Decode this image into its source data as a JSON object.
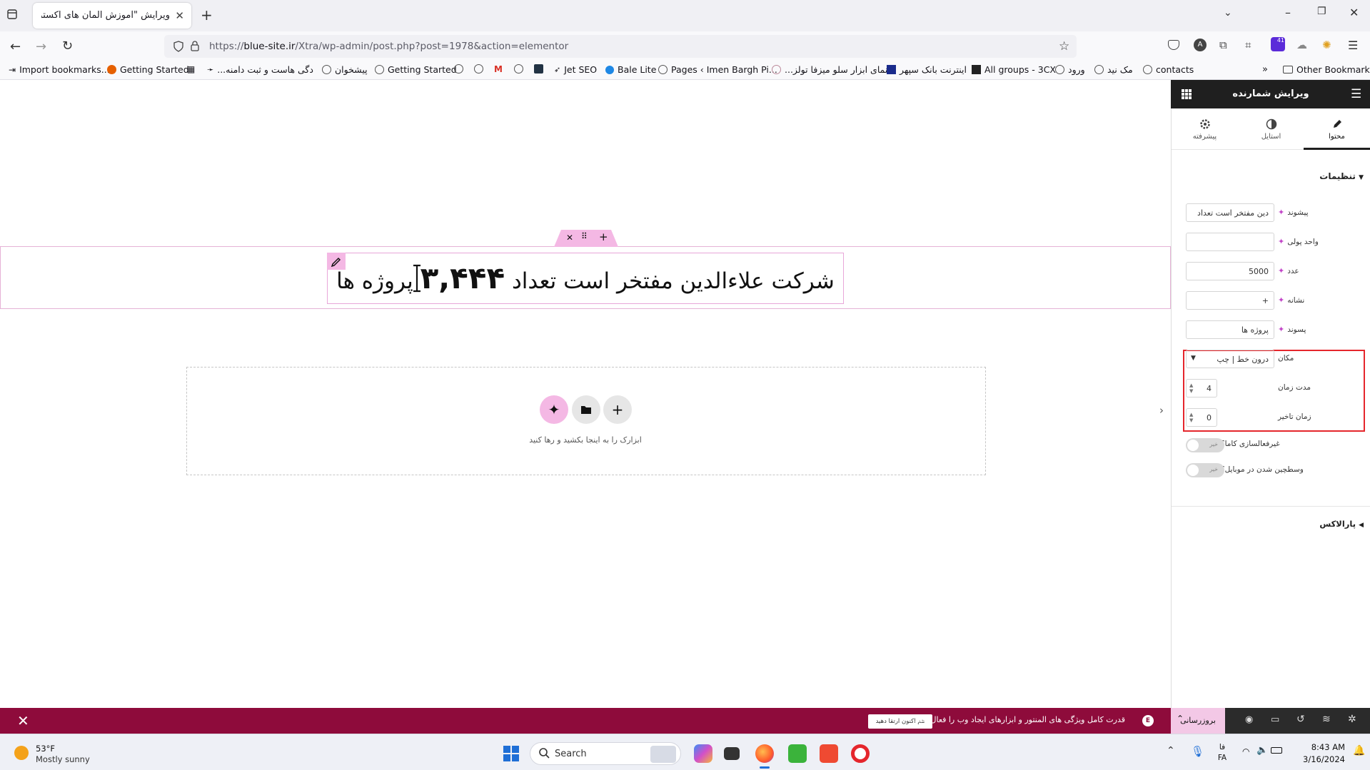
{
  "browser": {
    "tab_title": "ویرایش \"آموزش المان های اکسترا – ...",
    "url_prefix": "https://",
    "url_domain": "blue-site.ir",
    "url_rest": "/Xtra/wp-admin/post.php?post=1978&action=elementor",
    "extension_badge": "41",
    "bookmarks": [
      "Import bookmarks...",
      "Getting Started",
      "...دگی هاست و ثبت دامنه",
      "پیشخوان",
      "Getting Started",
      "Jet SEO",
      "Bale Lite",
      "Pages ‹ Imen Bargh Pi...",
      "...نمای ابزار سلو میزفا تولز",
      "اینترنت بانک سپهر",
      "All groups - 3CX",
      "ورود",
      "مک نید",
      "contacts"
    ],
    "other_bookmarks": "Other Bookmarks"
  },
  "canvas": {
    "counter_prefix": "شرکت علاءالدین مفتخر است تعداد",
    "counter_number": "۳,۴۴۴",
    "counter_suffix": "پروژه ها",
    "dropzone_text": "ابزارک را به اینجا بکشید و رها کنید"
  },
  "panel": {
    "title": "ویرایش شمارنده",
    "tabs": [
      "محتوا",
      "استایل",
      "پیشرفته"
    ],
    "section_title": "تنظیمات",
    "fields": {
      "prefix_label": "پیشوند",
      "prefix_value": "دین مفتخر است تعداد",
      "currency_label": "واحد پولی",
      "currency_value": "",
      "number_label": "عدد",
      "number_value": "5000",
      "separator_label": "نشانه",
      "separator_value": "+",
      "suffix_label": "پسوند",
      "suffix_value": "پروژه ها",
      "position_label": "مکان",
      "position_value": "درون خط | چپ",
      "duration_label": "مدت زمان",
      "duration_value": "4",
      "delay_label": "زمان تاخیر",
      "delay_value": "0",
      "localize_label": "غیرفعالسازی کاما؟",
      "localize_toggle": "خیر",
      "mobile_label": "وسطچین شدن در موبایل؟",
      "mobile_toggle": "خیر"
    },
    "section2_title": "پارالاکس"
  },
  "notice": {
    "text": "قدرت کامل ویژگی های المنتور و ابزارهای ایجاد وب را فعال کنید.",
    "cta": "هم اکنون ارتقا دهید",
    "update_button": "بروزرسانی"
  },
  "taskbar": {
    "temperature": "53°F",
    "weather_desc": "Mostly sunny",
    "search_placeholder": "Search",
    "lang_top": "فا",
    "lang_bottom": "FA",
    "time": "8:43 AM",
    "date": "3/16/2024"
  },
  "colors": {
    "accent_pink": "#f4b8e4",
    "notice_bg": "#8e0b3b",
    "highlight_red": "#e5262c",
    "panel_header": "#1f1f1f"
  }
}
